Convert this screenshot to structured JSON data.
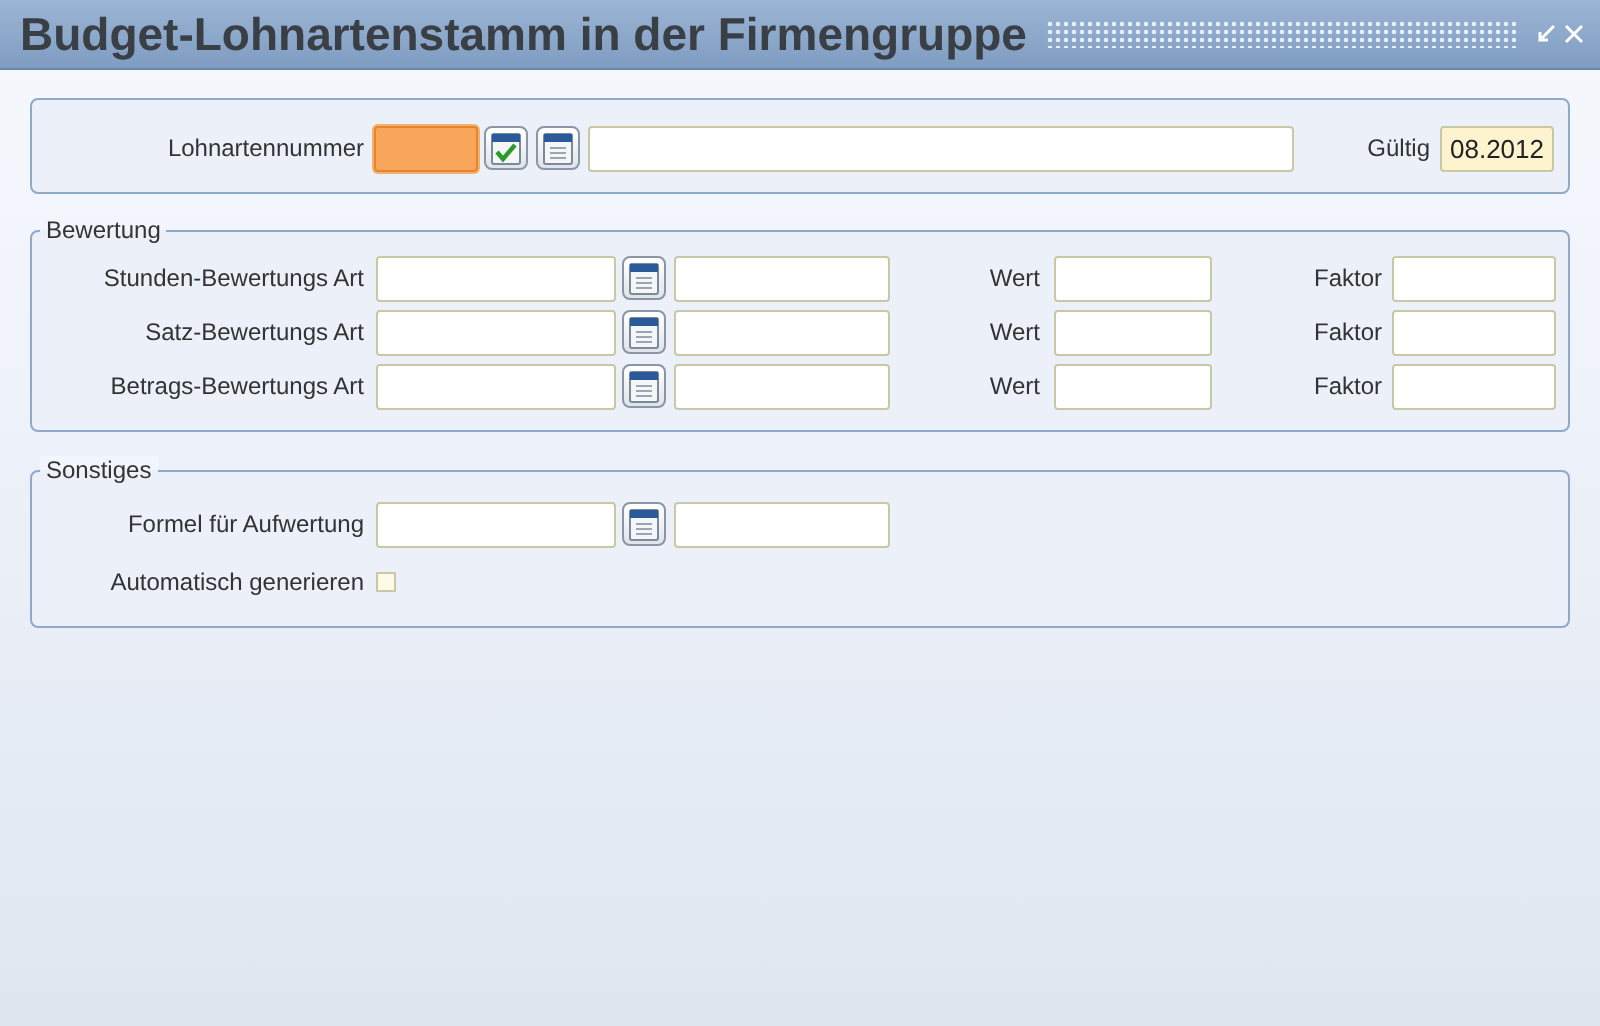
{
  "window": {
    "title": "Budget-Lohnartenstamm in der Firmengruppe"
  },
  "header": {
    "label": "Lohnartennummer",
    "number_focused": true,
    "buttons": [
      {
        "kind": "check"
      },
      {
        "kind": "lookup"
      }
    ],
    "valid_label": "Gültig",
    "valid": "08.2012"
  },
  "bewertung": {
    "legend": "Bewertung",
    "rows": [
      {
        "label": "Stunden-Bewertungs Art",
        "value_label": "Wert",
        "factor_label": "Faktor"
      },
      {
        "label": "Satz-Bewertungs Art",
        "value_label": "Wert",
        "factor_label": "Faktor"
      },
      {
        "label": "Betrags-Bewertungs Art",
        "value_label": "Wert",
        "factor_label": "Faktor"
      }
    ]
  },
  "sonstiges": {
    "legend": "Sonstiges",
    "formula_label": "Formel für Aufwertung",
    "auto_label": "Automatisch generieren",
    "auto_checked": false
  }
}
